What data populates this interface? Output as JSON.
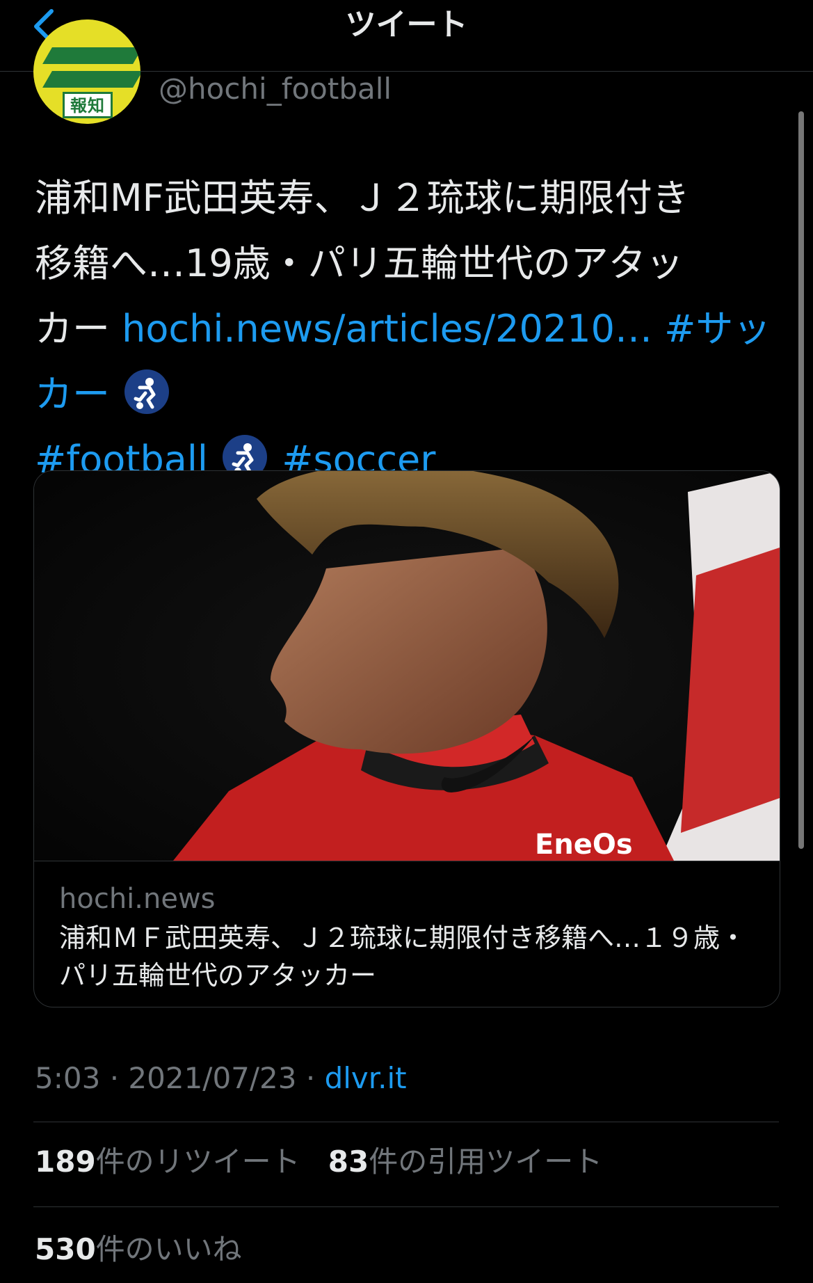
{
  "header": {
    "title": "ツイート",
    "back_icon": "chevron-left-icon"
  },
  "author": {
    "avatar_text": "報知",
    "handle": "@hochi_football"
  },
  "tweet": {
    "text_line1": "浦和MF武田英寿、Ｊ２琉球に期限付き",
    "text_line2": "移籍へ…19歳・パリ五輪世代のアタッ",
    "text_line3_prefix": "カー",
    "link": "hochi.news/articles/20210…",
    "hashtag1": "#サッカー",
    "hashtag2": "#football",
    "hashtag3": "#soccer",
    "emoji_icon": "soccer-player-icon"
  },
  "card": {
    "domain": "hochi.news",
    "title": "浦和ＭＦ武田英寿、Ｊ２琉球に期限付き移籍へ…１９歳・パリ五輪世代のアタッカー"
  },
  "meta": {
    "time": "5:03",
    "separator": "·",
    "date": "2021/07/23",
    "source": "dlvr.it"
  },
  "stats": {
    "retweets_count": "189",
    "retweets_label": "件のリツイート",
    "quotes_count": "83",
    "quotes_label": "件の引用ツイート",
    "likes_count": "530",
    "likes_label": "件のいいね"
  },
  "colors": {
    "background": "#000000",
    "text": "#e7e9ea",
    "secondary": "#71767b",
    "accent": "#1d9bf0",
    "divider": "#2f3336"
  }
}
